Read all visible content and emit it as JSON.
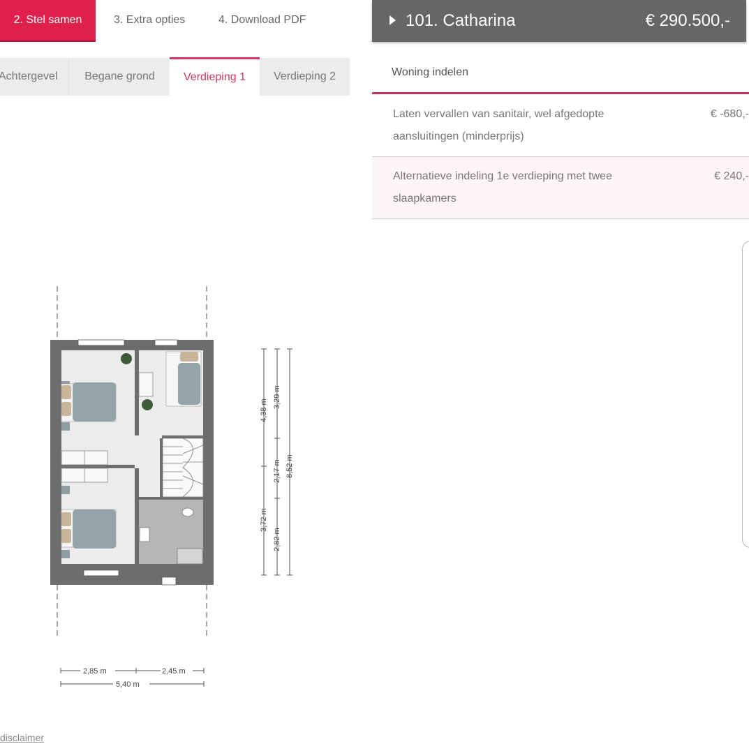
{
  "steps": [
    {
      "label": "2. Stel samen",
      "active": true
    },
    {
      "label": "3. Extra opties",
      "active": false
    },
    {
      "label": "4. Download PDF",
      "active": false
    }
  ],
  "floor_tabs": [
    {
      "label": "Achtergevel"
    },
    {
      "label": "Begane grond"
    },
    {
      "label": "Verdieping 1",
      "active": true
    },
    {
      "label": "Verdieping 2"
    }
  ],
  "house": {
    "name": "101. Catharina",
    "price": "€ 290.500,-"
  },
  "section": {
    "title": "Woning indelen"
  },
  "options": [
    {
      "label": "Laten vervallen van sanitair, wel afgedopte aansluitingen (minderprijs)",
      "price": "€ -680,-"
    },
    {
      "label": "Alternatieve indeling 1e verdieping met twee slaapkamers",
      "price": "€ 240,-"
    }
  ],
  "plan": {
    "dims": {
      "top_width_left": "2,85",
      "top_width_right": "2,45",
      "total_width": "5,40",
      "v_front": "4,38",
      "v_back": "3,72",
      "v_room1": "3,29",
      "v_stair": "2,17",
      "v_bath": "2,82",
      "v_total": "8,52",
      "unit": "m"
    }
  },
  "footer": {
    "disclaimer": "disclaimer"
  },
  "colors": {
    "accent": "#e0204c",
    "header_bg": "#666666",
    "section_line": "#c8325a"
  }
}
